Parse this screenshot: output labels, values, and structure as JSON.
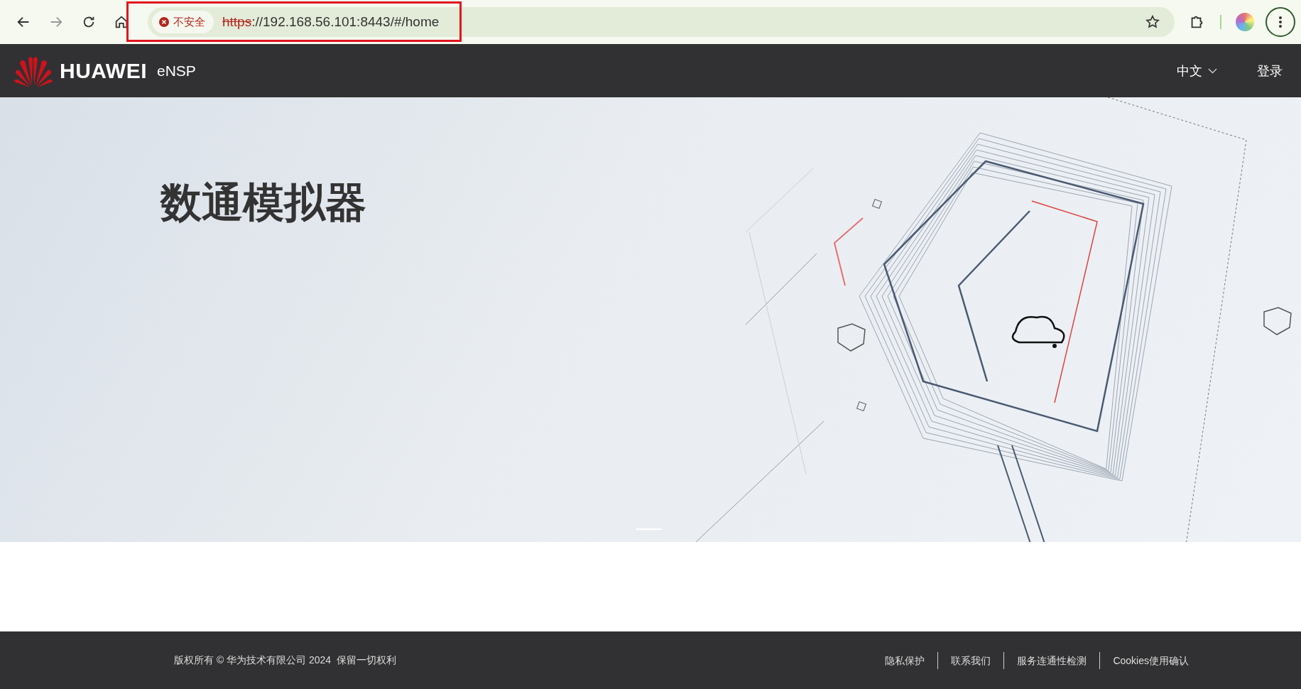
{
  "browser": {
    "address_bar": {
      "security_label": "不安全",
      "scheme": "https",
      "rest": "://192.168.56.101:8443/#/home",
      "highlighted": true
    }
  },
  "header": {
    "brand": "HUAWEI",
    "product": "eNSP",
    "language": "中文",
    "login": "登录"
  },
  "hero": {
    "title": "数通模拟器",
    "slides": [
      {
        "selected": true
      }
    ]
  },
  "footer": {
    "copyright": "版权所有 © 华为技术有限公司 2024  保留一切权利",
    "links": [
      "隐私保护",
      "联系我们",
      "服务连通性检测",
      "Cookies使用确认"
    ]
  }
}
